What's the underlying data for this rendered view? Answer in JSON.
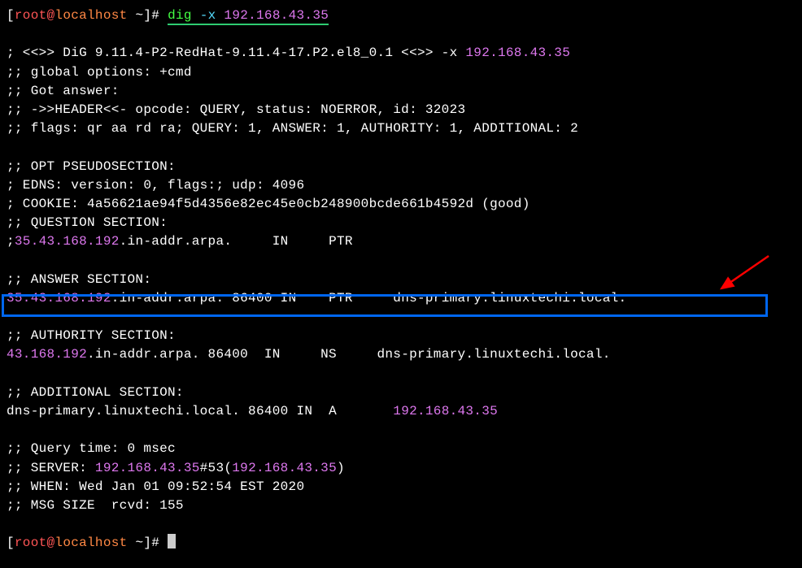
{
  "prompt1": {
    "bracket_open": "[",
    "user": "root",
    "at": "@",
    "host": "localhost",
    "tilde": " ~",
    "bracket_close": "]# ",
    "cmd": "dig",
    "sp": " ",
    "flag": "-x",
    "sp2": " ",
    "ip": "192.168.43.35"
  },
  "blank1": " ",
  "lversion": "; <<>> DiG 9.11.4-P2-RedHat-9.11.4-17.P2.el8_0.1 <<>> -x ",
  "lversion_ip": "192.168.43.35",
  "lglobal": ";; global options: +cmd",
  "lgot": ";; Got answer:",
  "lheader": ";; ->>HEADER<<- opcode: QUERY, status: NOERROR, id: 32023",
  "lflags": ";; flags: qr aa rd ra; QUERY: 1, ANSWER: 1, AUTHORITY: 1, ADDITIONAL: 2",
  "blank2": " ",
  "loptpseudo": ";; OPT PSEUDOSECTION:",
  "ledns": "; EDNS: version: 0, flags:; udp: 4096",
  "lcookie": "; COOKIE: 4a56621ae94f5d4356e82ec45e0cb248900bcde661b4592d (good)",
  "lquestion_hdr": ";; QUESTION SECTION:",
  "lquestion": {
    "semi": ";",
    "name": "35.43.168.192",
    "rest": ".in-addr.arpa.     IN     PTR"
  },
  "blank3": " ",
  "lanswer_hdr": ";; ANSWER SECTION:",
  "lanswer": {
    "name": "35.43.168.192",
    "rest1": ".in-addr.arpa. 86400 IN    PTR     ",
    "target": "dns-primary.linuxtechi.local."
  },
  "blank4": " ",
  "lauth_hdr": ";; AUTHORITY SECTION:",
  "lauth": {
    "name": "43.168.192",
    "rest1": ".in-addr.arpa. 86400  IN     NS     ",
    "target": "dns-primary.linuxtechi.local."
  },
  "blank5": " ",
  "ladd_hdr": ";; ADDITIONAL SECTION:",
  "ladd": {
    "name": "dns-primary.linuxtechi.local.",
    "rest1": " 86400 IN  A       ",
    "ip": "192.168.43.35"
  },
  "blank6": " ",
  "lqtime": ";; Query time: 0 msec",
  "lserver": {
    "pre": ";; SERVER: ",
    "ip1": "192.168.43.35",
    "mid": "#53(",
    "ip2": "192.168.43.35",
    "post": ")"
  },
  "lwhen": ";; WHEN: Wed Jan 01 09:52:54 EST 2020",
  "lmsg": ";; MSG SIZE  rcvd: 155",
  "blank7": " ",
  "prompt2": {
    "bracket_open": "[",
    "user": "root",
    "at": "@",
    "host": "localhost",
    "tilde": " ~",
    "bracket_close": "]# "
  }
}
